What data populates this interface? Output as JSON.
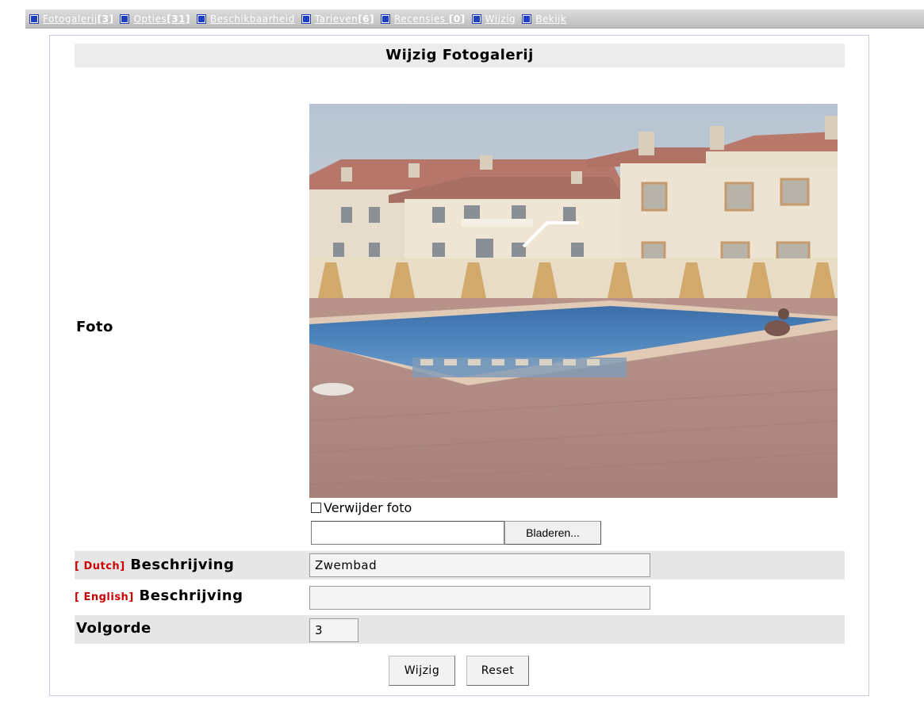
{
  "nav": {
    "items": [
      {
        "text": "Fotogalerij",
        "count": "[3]"
      },
      {
        "text": "Opties",
        "count": "[31]"
      },
      {
        "text": "Beschikbaarheid",
        "count": ""
      },
      {
        "text": "Tarieven",
        "count": "[6]"
      },
      {
        "text": "Recensies ",
        "count": "[0]"
      },
      {
        "text": "Wijzig",
        "count": ""
      },
      {
        "text": "Bekijk",
        "count": ""
      }
    ]
  },
  "header": {
    "title": "Wijzig Fotogalerij"
  },
  "photo": {
    "label": "Foto",
    "delete_label": "Verwijder foto",
    "file_value": "",
    "browse_label": "Bladeren..."
  },
  "fields": {
    "dutch": {
      "lang": "[ Dutch]",
      "label": "Beschrijving",
      "value": "Zwembad"
    },
    "english": {
      "lang": "[ English]",
      "label": "Beschrijving",
      "value": ""
    },
    "order": {
      "label": "Volgorde",
      "value": "3"
    }
  },
  "buttons": {
    "submit": "Wijzig",
    "reset": "Reset"
  },
  "colors": {
    "lang_accent": "#cc0000",
    "nav_bullet": "#1f3fbf"
  }
}
